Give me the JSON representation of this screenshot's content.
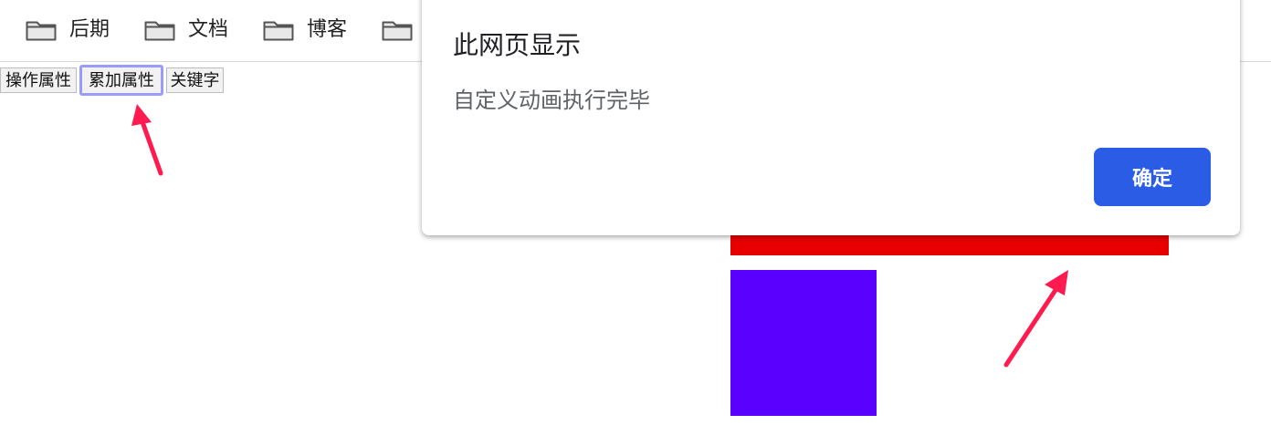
{
  "bookmarks": {
    "items": [
      {
        "label": "后期",
        "icon": "folder-icon"
      },
      {
        "label": "文档",
        "icon": "folder-icon"
      },
      {
        "label": "博客",
        "icon": "folder-icon"
      },
      {
        "label": "",
        "icon": "folder-icon"
      }
    ]
  },
  "buttons": {
    "operate": "操作属性",
    "accumulate": "累加属性",
    "keyword": "关键字"
  },
  "dialog": {
    "title": "此网页显示",
    "message": "自定义动画执行完毕",
    "ok_label": "确定"
  },
  "colors": {
    "red_bar": "#e60000",
    "purple_box": "#5a00ff",
    "arrow": "#ff1a4f",
    "dialog_button": "#2b5ce6",
    "focus_ring": "#9a9bff"
  }
}
